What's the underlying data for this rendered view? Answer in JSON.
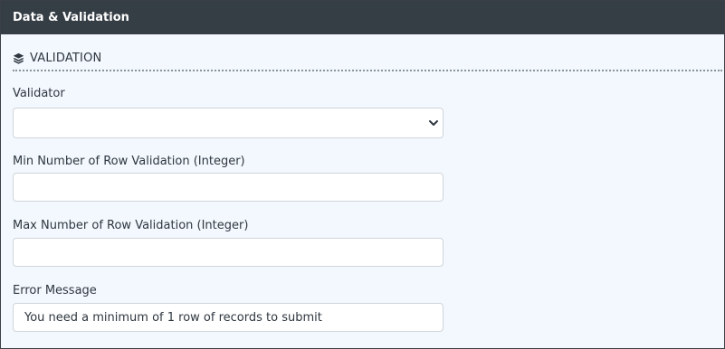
{
  "panel": {
    "title": "Data & Validation"
  },
  "section": {
    "title": "VALIDATION",
    "icon": "layers-icon"
  },
  "fields": {
    "validator": {
      "label": "Validator",
      "value": ""
    },
    "min_rows": {
      "label": "Min Number of Row Validation (Integer)",
      "value": ""
    },
    "max_rows": {
      "label": "Max Number of Row Validation (Integer)",
      "value": ""
    },
    "error_message": {
      "label": "Error Message",
      "value": "You need a minimum of 1 row of records to submit"
    }
  }
}
